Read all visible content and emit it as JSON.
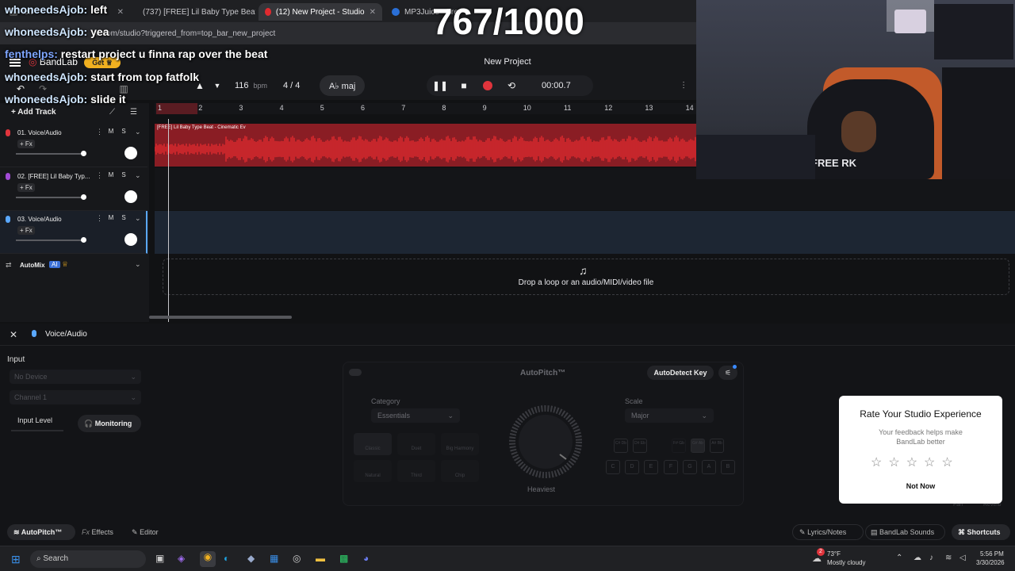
{
  "browser": {
    "tabs": [
      {
        "label": "left"
      },
      {
        "label": "(737) [FREE] Lil Baby Type Beat"
      },
      {
        "label": "(12) New Project - Studio"
      },
      {
        "label": "MP3Juice - Fre"
      }
    ],
    "url": "m.com/studio?triggered_from=top_bar_new_project"
  },
  "chat": [
    {
      "user": "whoneedsAjob:",
      "text": "left"
    },
    {
      "user": "whoneedsAjob:",
      "text": "yea"
    },
    {
      "user": "fenthelps:",
      "text": "restart project u finna rap over the beat"
    },
    {
      "user": "whoneedsAjob:",
      "text": "start from top fatfolk"
    },
    {
      "user": "whoneedsAjob:",
      "text": "slide it"
    }
  ],
  "counter": "767/1000",
  "header": {
    "logo": "BandLab",
    "get_label": "Get",
    "project_title": "New Project",
    "tempo_value": "116",
    "tempo_unit": "bpm",
    "time_sig": "4 / 4",
    "key": "A♭ maj",
    "time": "00:00.7"
  },
  "ruler": [
    "1",
    "2",
    "3",
    "4",
    "5",
    "6",
    "7",
    "8",
    "9",
    "10",
    "11",
    "12",
    "13",
    "14"
  ],
  "sidebar": {
    "add_track": "Add Track",
    "automix": "AutoMix",
    "ai_badge": "AI"
  },
  "tracks": [
    {
      "name": "01. Voice/Audio",
      "fx": "+ Fx",
      "mute": "M",
      "solo": "S",
      "color": "#e0343c"
    },
    {
      "name": "02. [FREE] Lil Baby Typ...",
      "fx": "+ Fx",
      "mute": "M",
      "solo": "S",
      "color": "#a24bd6"
    },
    {
      "name": "03. Voice/Audio",
      "fx": "+ Fx",
      "mute": "M",
      "solo": "S",
      "color": "#5aa8ff"
    }
  ],
  "clip": {
    "label": "[FREE] Lil Baby Type Beat - Cinematic Ev"
  },
  "drop_zone": "Drop a loop or an audio/MIDI/video file",
  "lower_panel": {
    "track_title": "Voice/Audio",
    "input_label": "Input",
    "device_placeholder": "No Device",
    "channel_placeholder": "Channel 1",
    "input_level": "Input Level",
    "monitoring": "Monitoring"
  },
  "autopitch": {
    "title": "AutoPitch™",
    "autodetect": "AutoDetect Key",
    "category_label": "Category",
    "category_value": "Essentials",
    "scale_label": "Scale",
    "scale_value": "Major",
    "presets": [
      "Classic",
      "Duet",
      "Big Harmony",
      "Natural",
      "Third",
      "Chip"
    ],
    "knob_label": "Heaviest",
    "note_keys_sharp": [
      "C# Db",
      "D# Eb",
      "F# Gb",
      "G# Ab",
      "A# Bb"
    ],
    "note_keys": [
      "C",
      "D",
      "E",
      "F",
      "G",
      "A",
      "B"
    ],
    "side_labels": [
      "Fan",
      "Reverb"
    ]
  },
  "rating_card": {
    "title": "Rate Your Studio Experience",
    "subtitle": "Your feedback helps make BandLab better",
    "stars": 5,
    "dismiss": "Not Now"
  },
  "bottom_tabs": {
    "autopitch": "AutoPitch™",
    "effects": "Effects",
    "editor": "Editor",
    "lyrics": "Lyrics/Notes",
    "sounds": "BandLab Sounds",
    "shortcuts": "Shortcuts"
  },
  "taskbar": {
    "search": "Search",
    "weather_temp": "73°F",
    "weather_desc": "Mostly cloudy",
    "time": "5:56 PM",
    "date": "3/30/2026",
    "notif_badge": "2"
  },
  "colors": {
    "accent_red": "#e0343c",
    "clip_red": "#e02a2f",
    "get_yellow": "#f0b020"
  }
}
